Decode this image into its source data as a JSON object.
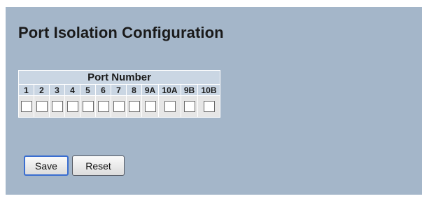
{
  "page": {
    "title": "Port Isolation Configuration"
  },
  "ports_table": {
    "header": "Port Number",
    "ports": [
      {
        "label": "1",
        "checked": false
      },
      {
        "label": "2",
        "checked": false
      },
      {
        "label": "3",
        "checked": false
      },
      {
        "label": "4",
        "checked": false
      },
      {
        "label": "5",
        "checked": false
      },
      {
        "label": "6",
        "checked": false
      },
      {
        "label": "7",
        "checked": false
      },
      {
        "label": "8",
        "checked": false
      },
      {
        "label": "9A",
        "checked": false
      },
      {
        "label": "10A",
        "checked": false
      },
      {
        "label": "9B",
        "checked": false
      },
      {
        "label": "10B",
        "checked": false
      }
    ]
  },
  "buttons": {
    "save": "Save",
    "reset": "Reset"
  },
  "colors": {
    "panel_background": "#a4b6c9",
    "table_header_background": "#cad6e3",
    "checkbox_row_background": "#e6e6e6",
    "focused_button_border": "#3a6ed0"
  }
}
